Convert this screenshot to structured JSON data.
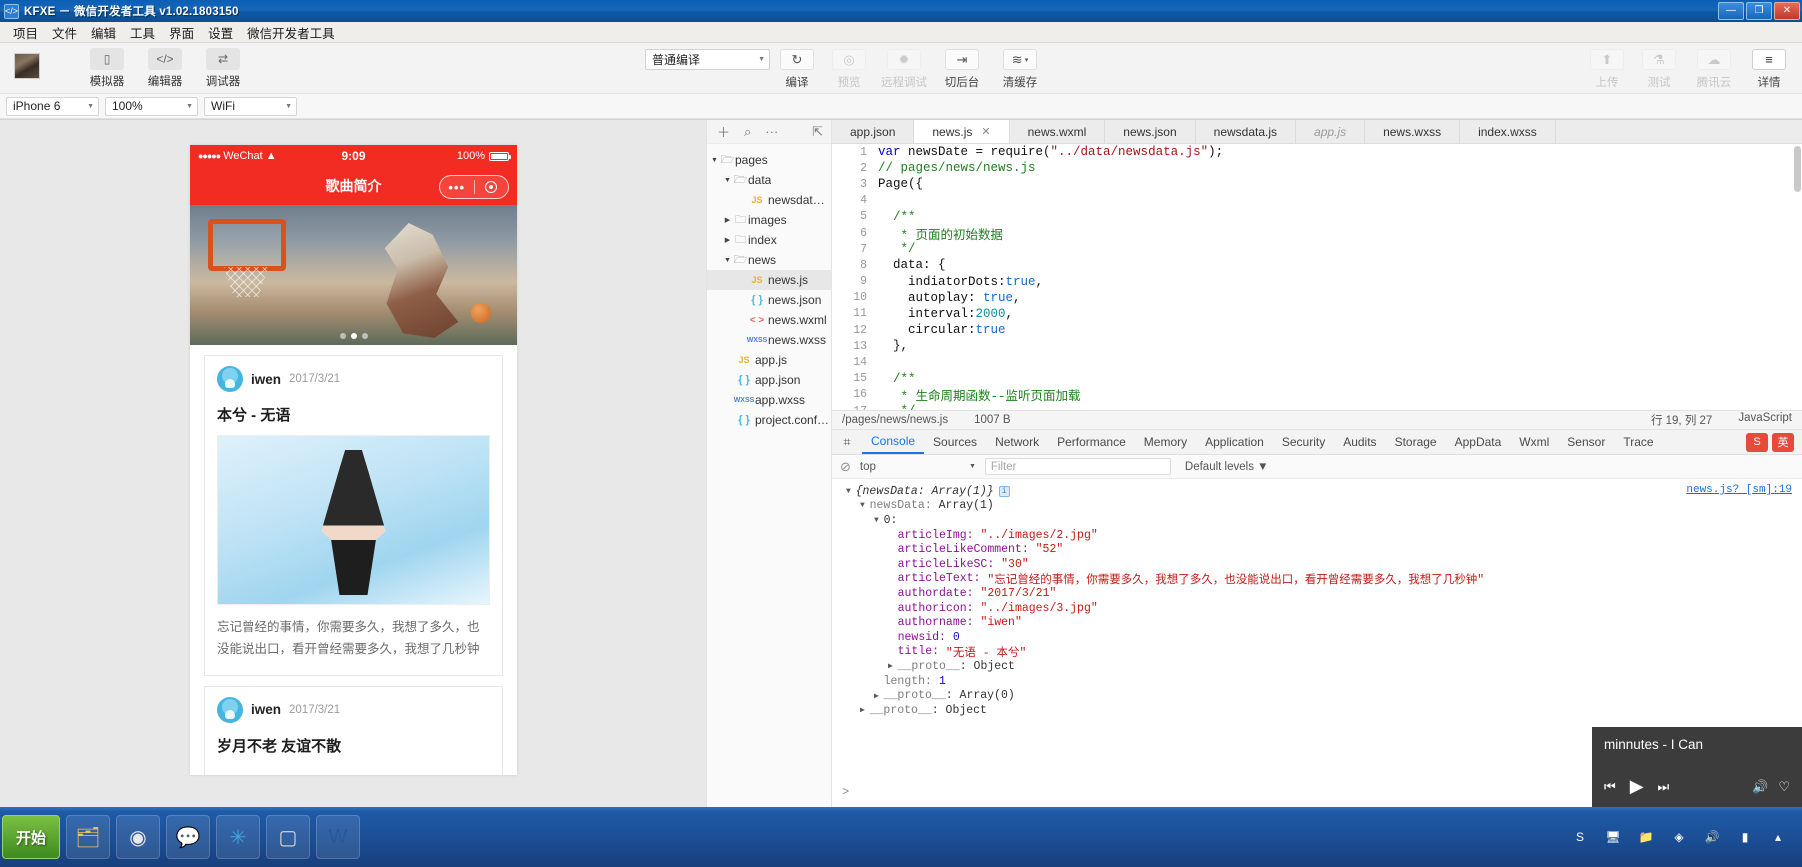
{
  "titlebar": {
    "app_icon": "code-icon",
    "title": "KFXE － 微信开发者工具 v1.02.1803150",
    "minimize": "—",
    "maximize": "❐",
    "close": "✕"
  },
  "menubar": {
    "items": [
      "项目",
      "文件",
      "编辑",
      "工具",
      "界面",
      "设置",
      "微信开发者工具"
    ]
  },
  "toolbar": {
    "left_buttons": [
      {
        "label": "模拟器",
        "icon": "phone-icon",
        "glyph": "▯",
        "disabled": false
      },
      {
        "label": "编辑器",
        "icon": "code-icon",
        "glyph": "</>",
        "disabled": false
      },
      {
        "label": "调试器",
        "icon": "debug-icon",
        "glyph": "⇄",
        "disabled": false
      }
    ],
    "compile_mode": {
      "value": "普通编译",
      "caret": "▼"
    },
    "center_buttons": [
      {
        "label": "编译",
        "icon": "refresh-icon",
        "glyph": "↻",
        "disabled": false
      },
      {
        "label": "预览",
        "icon": "eye-icon",
        "glyph": "◎",
        "disabled": true
      },
      {
        "label": "远程调试",
        "icon": "bug-icon",
        "glyph": "✹",
        "disabled": true
      },
      {
        "label": "切后台",
        "icon": "background-icon",
        "glyph": "⇥",
        "disabled": false
      },
      {
        "label": "清缓存",
        "icon": "layers-icon",
        "glyph": "≋",
        "disabled": false,
        "caret": "▾"
      }
    ],
    "right_buttons": [
      {
        "label": "上传",
        "icon": "upload-icon",
        "glyph": "⬆",
        "disabled": true
      },
      {
        "label": "测试",
        "icon": "flask-icon",
        "glyph": "⚗",
        "disabled": true
      },
      {
        "label": "腾讯云",
        "icon": "cloud-icon",
        "glyph": "☁",
        "disabled": true
      },
      {
        "label": "详情",
        "icon": "details-icon",
        "glyph": "≡",
        "disabled": false
      }
    ]
  },
  "devicebar": {
    "device": "iPhone 6",
    "zoom": "100%",
    "network": "WiFi",
    "caret": "▼"
  },
  "simulator": {
    "status": {
      "carrier_dots": "●●●●●",
      "carrier": "WeChat",
      "wifi_icon": "wifi-icon",
      "time": "9:09",
      "battery_text": "100%"
    },
    "nav_title": "歌曲简介",
    "capsule": {
      "more": "•••",
      "close": "⊙"
    },
    "banner": {
      "icon": "basketball-banner",
      "dot_count": 3,
      "active_dot": 1
    },
    "cards": [
      {
        "author": "iwen",
        "date": "2017/3/21",
        "title": "本兮 - 无语",
        "image": "girl-photo",
        "text": "忘记曾经的事情，你需要多久，我想了多久，也没能说出口，看开曾经需要多久，我想了几秒钟"
      },
      {
        "author": "iwen",
        "date": "2017/3/21",
        "title": "岁月不老   友谊不散",
        "image": "",
        "text": ""
      }
    ]
  },
  "explorer": {
    "toolbar_icons": [
      "plus-icon",
      "search-icon",
      "more-icon",
      "collapse-icon"
    ],
    "toolbar_glyphs": [
      "＋",
      "⌕",
      "···",
      "⇱"
    ],
    "tree": [
      {
        "depth": 0,
        "twisty": "▼",
        "kind": "folder-open",
        "name": "pages",
        "selected": false
      },
      {
        "depth": 1,
        "twisty": "▼",
        "kind": "folder-open",
        "name": "data",
        "selected": false
      },
      {
        "depth": 2,
        "twisty": "",
        "kind": "js",
        "badge": "JS",
        "name": "newsdat…",
        "selected": false
      },
      {
        "depth": 1,
        "twisty": "▶",
        "kind": "folder",
        "name": "images",
        "selected": false
      },
      {
        "depth": 1,
        "twisty": "▶",
        "kind": "folder",
        "name": "index",
        "selected": false
      },
      {
        "depth": 1,
        "twisty": "▼",
        "kind": "folder-open",
        "name": "news",
        "selected": false
      },
      {
        "depth": 2,
        "twisty": "",
        "kind": "js",
        "badge": "JS",
        "name": "news.js",
        "selected": true
      },
      {
        "depth": 2,
        "twisty": "",
        "kind": "json",
        "badge": "{ }",
        "name": "news.json",
        "selected": false
      },
      {
        "depth": 2,
        "twisty": "",
        "kind": "wxml",
        "badge": "< >",
        "name": "news.wxml",
        "selected": false
      },
      {
        "depth": 2,
        "twisty": "",
        "kind": "wxss",
        "badge": "WXSS",
        "name": "news.wxss",
        "selected": false
      },
      {
        "depth": 1,
        "twisty": "",
        "kind": "js",
        "badge": "JS",
        "name": "app.js",
        "selected": false
      },
      {
        "depth": 1,
        "twisty": "",
        "kind": "json",
        "badge": "{ }",
        "name": "app.json",
        "selected": false
      },
      {
        "depth": 1,
        "twisty": "",
        "kind": "wxss",
        "badge": "WXSS",
        "name": "app.wxss",
        "selected": false
      },
      {
        "depth": 1,
        "twisty": "",
        "kind": "json",
        "badge": "{ }",
        "name": "project.confi…",
        "selected": false
      }
    ]
  },
  "editor": {
    "tabs": [
      {
        "label": "app.json",
        "active": false,
        "italic": false,
        "closable": false
      },
      {
        "label": "news.js",
        "active": true,
        "italic": false,
        "closable": true,
        "close": "✕"
      },
      {
        "label": "news.wxml",
        "active": false,
        "italic": false,
        "closable": false
      },
      {
        "label": "news.json",
        "active": false,
        "italic": false,
        "closable": false
      },
      {
        "label": "newsdata.js",
        "active": false,
        "italic": false,
        "closable": false
      },
      {
        "label": "app.js",
        "active": false,
        "italic": true,
        "closable": false
      },
      {
        "label": "news.wxss",
        "active": false,
        "italic": false,
        "closable": false
      },
      {
        "label": "index.wxss",
        "active": false,
        "italic": false,
        "closable": false
      }
    ],
    "lines": [
      {
        "n": "1",
        "code": "var newsDate = require(\"../data/newsdata.js\");"
      },
      {
        "n": "2",
        "code": "// pages/news/news.js"
      },
      {
        "n": "3",
        "code": "Page({"
      },
      {
        "n": "4",
        "code": ""
      },
      {
        "n": "5",
        "code": "  /**"
      },
      {
        "n": "6",
        "code": "   * 页面的初始数据"
      },
      {
        "n": "7",
        "code": "   */"
      },
      {
        "n": "8",
        "code": "  data: {"
      },
      {
        "n": "9",
        "code": "    indiatorDots:true,"
      },
      {
        "n": "10",
        "code": "    autoplay: true,"
      },
      {
        "n": "11",
        "code": "    interval:2000,"
      },
      {
        "n": "12",
        "code": "    circular:true"
      },
      {
        "n": "13",
        "code": "  },"
      },
      {
        "n": "14",
        "code": ""
      },
      {
        "n": "15",
        "code": "  /**"
      },
      {
        "n": "16",
        "code": "   * 生命周期函数--监听页面加载"
      },
      {
        "n": "17",
        "code": "   */"
      }
    ],
    "statusline": {
      "path": "/pages/news/news.js",
      "size": "1007 B",
      "cursor": "行 19, 列 27",
      "language": "JavaScript"
    }
  },
  "devtools": {
    "inspect_icon": "inspect-icon",
    "tabs": [
      "Console",
      "Sources",
      "Network",
      "Performance",
      "Memory",
      "Application",
      "Security",
      "Audits",
      "Storage",
      "AppData",
      "Wxml",
      "Sensor",
      "Trace"
    ],
    "active_tab": "Console",
    "ime_badges": [
      "S",
      "英"
    ],
    "filterbar": {
      "clear_icon": "clear-console-icon",
      "clear_glyph": "⊘",
      "context": "top",
      "context_caret": "▼",
      "filter_placeholder": "Filter",
      "levels": "Default levels",
      "levels_caret": "▼"
    },
    "source_link": "news.js? [sm]:19",
    "console_lines": [
      {
        "indent": 0,
        "twisty": "▼",
        "parts": [
          {
            "t": "{newsData: Array(1)}",
            "c": "c-ital"
          }
        ],
        "info": true
      },
      {
        "indent": 1,
        "twisty": "▼",
        "parts": [
          {
            "t": "newsData: ",
            "c": "c-gray"
          },
          {
            "t": "Array(1)",
            "c": ""
          }
        ]
      },
      {
        "indent": 2,
        "twisty": "▼",
        "parts": [
          {
            "t": "0:",
            "c": ""
          }
        ]
      },
      {
        "indent": 3,
        "twisty": "",
        "parts": [
          {
            "t": "articleImg: ",
            "c": "c-key"
          },
          {
            "t": "\"../images/2.jpg\"",
            "c": "c-str"
          }
        ]
      },
      {
        "indent": 3,
        "twisty": "",
        "parts": [
          {
            "t": "articleLikeComment: ",
            "c": "c-key"
          },
          {
            "t": "\"52\"",
            "c": "c-str"
          }
        ]
      },
      {
        "indent": 3,
        "twisty": "",
        "parts": [
          {
            "t": "articleLikeSC: ",
            "c": "c-key"
          },
          {
            "t": "\"30\"",
            "c": "c-str"
          }
        ]
      },
      {
        "indent": 3,
        "twisty": "",
        "parts": [
          {
            "t": "articleText: ",
            "c": "c-key"
          },
          {
            "t": "\"忘记曾经的事情，你需要多久，我想了多久，也没能说出口，看开曾经需要多久，我想了几秒钟\"",
            "c": "c-str"
          }
        ]
      },
      {
        "indent": 3,
        "twisty": "",
        "parts": [
          {
            "t": "authordate: ",
            "c": "c-key"
          },
          {
            "t": "\"2017/3/21\"",
            "c": "c-str"
          }
        ]
      },
      {
        "indent": 3,
        "twisty": "",
        "parts": [
          {
            "t": "authoricon: ",
            "c": "c-key"
          },
          {
            "t": "\"../images/3.jpg\"",
            "c": "c-str"
          }
        ]
      },
      {
        "indent": 3,
        "twisty": "",
        "parts": [
          {
            "t": "authorname: ",
            "c": "c-key"
          },
          {
            "t": "\"iwen\"",
            "c": "c-str"
          }
        ]
      },
      {
        "indent": 3,
        "twisty": "",
        "parts": [
          {
            "t": "newsid: ",
            "c": "c-key"
          },
          {
            "t": "0",
            "c": "c-num"
          }
        ]
      },
      {
        "indent": 3,
        "twisty": "",
        "parts": [
          {
            "t": "title: ",
            "c": "c-key"
          },
          {
            "t": "\"无语 - 本兮\"",
            "c": "c-str"
          }
        ]
      },
      {
        "indent": 3,
        "twisty": "▶",
        "parts": [
          {
            "t": "__proto__",
            "c": "c-gray"
          },
          {
            "t": ": Object",
            "c": ""
          }
        ]
      },
      {
        "indent": 2,
        "twisty": "",
        "parts": [
          {
            "t": "length: ",
            "c": "c-gray"
          },
          {
            "t": "1",
            "c": "c-num"
          }
        ]
      },
      {
        "indent": 2,
        "twisty": "▶",
        "parts": [
          {
            "t": "__proto__",
            "c": "c-gray"
          },
          {
            "t": ": Array(0)",
            "c": ""
          }
        ]
      },
      {
        "indent": 1,
        "twisty": "▶",
        "parts": [
          {
            "t": "__proto__",
            "c": "c-gray"
          },
          {
            "t": ": Object",
            "c": ""
          }
        ]
      }
    ],
    "prompt": ">"
  },
  "player": {
    "title": "minnutes - I Can",
    "prev": "⏮",
    "play": "▶",
    "next": "⏭",
    "volume": "🔊",
    "heart": "♡"
  },
  "taskbar": {
    "start": "开始",
    "items": [
      {
        "icon": "folder-icon",
        "glyph": "🗂",
        "color": "#f0c25a"
      },
      {
        "icon": "chrome-icon",
        "glyph": "◉",
        "color": "#e8e8e8"
      },
      {
        "icon": "wechat-icon",
        "glyph": "💬",
        "color": "#4ec04e"
      },
      {
        "icon": "devtool-icon",
        "glyph": "✳",
        "color": "#3fa7dd"
      },
      {
        "icon": "window-icon",
        "glyph": "▢",
        "color": "#d8d8d8"
      },
      {
        "icon": "word-icon",
        "glyph": "W",
        "color": "#2b5797"
      }
    ],
    "tray": [
      {
        "icon": "sogou-icon",
        "glyph": "S"
      },
      {
        "icon": "monitor-icon",
        "glyph": "🖥"
      },
      {
        "icon": "folder-tray-icon",
        "glyph": "📁"
      },
      {
        "icon": "shield-icon",
        "glyph": "◈"
      },
      {
        "icon": "volume-icon",
        "glyph": "🔊"
      },
      {
        "icon": "network-icon",
        "glyph": "▮"
      },
      {
        "icon": "chevron-up-icon",
        "glyph": "▴"
      }
    ]
  },
  "colors": {
    "titlebar": "#0d5aa8",
    "wechat_red": "#f22c22",
    "accent_blue": "#1a73e8"
  }
}
